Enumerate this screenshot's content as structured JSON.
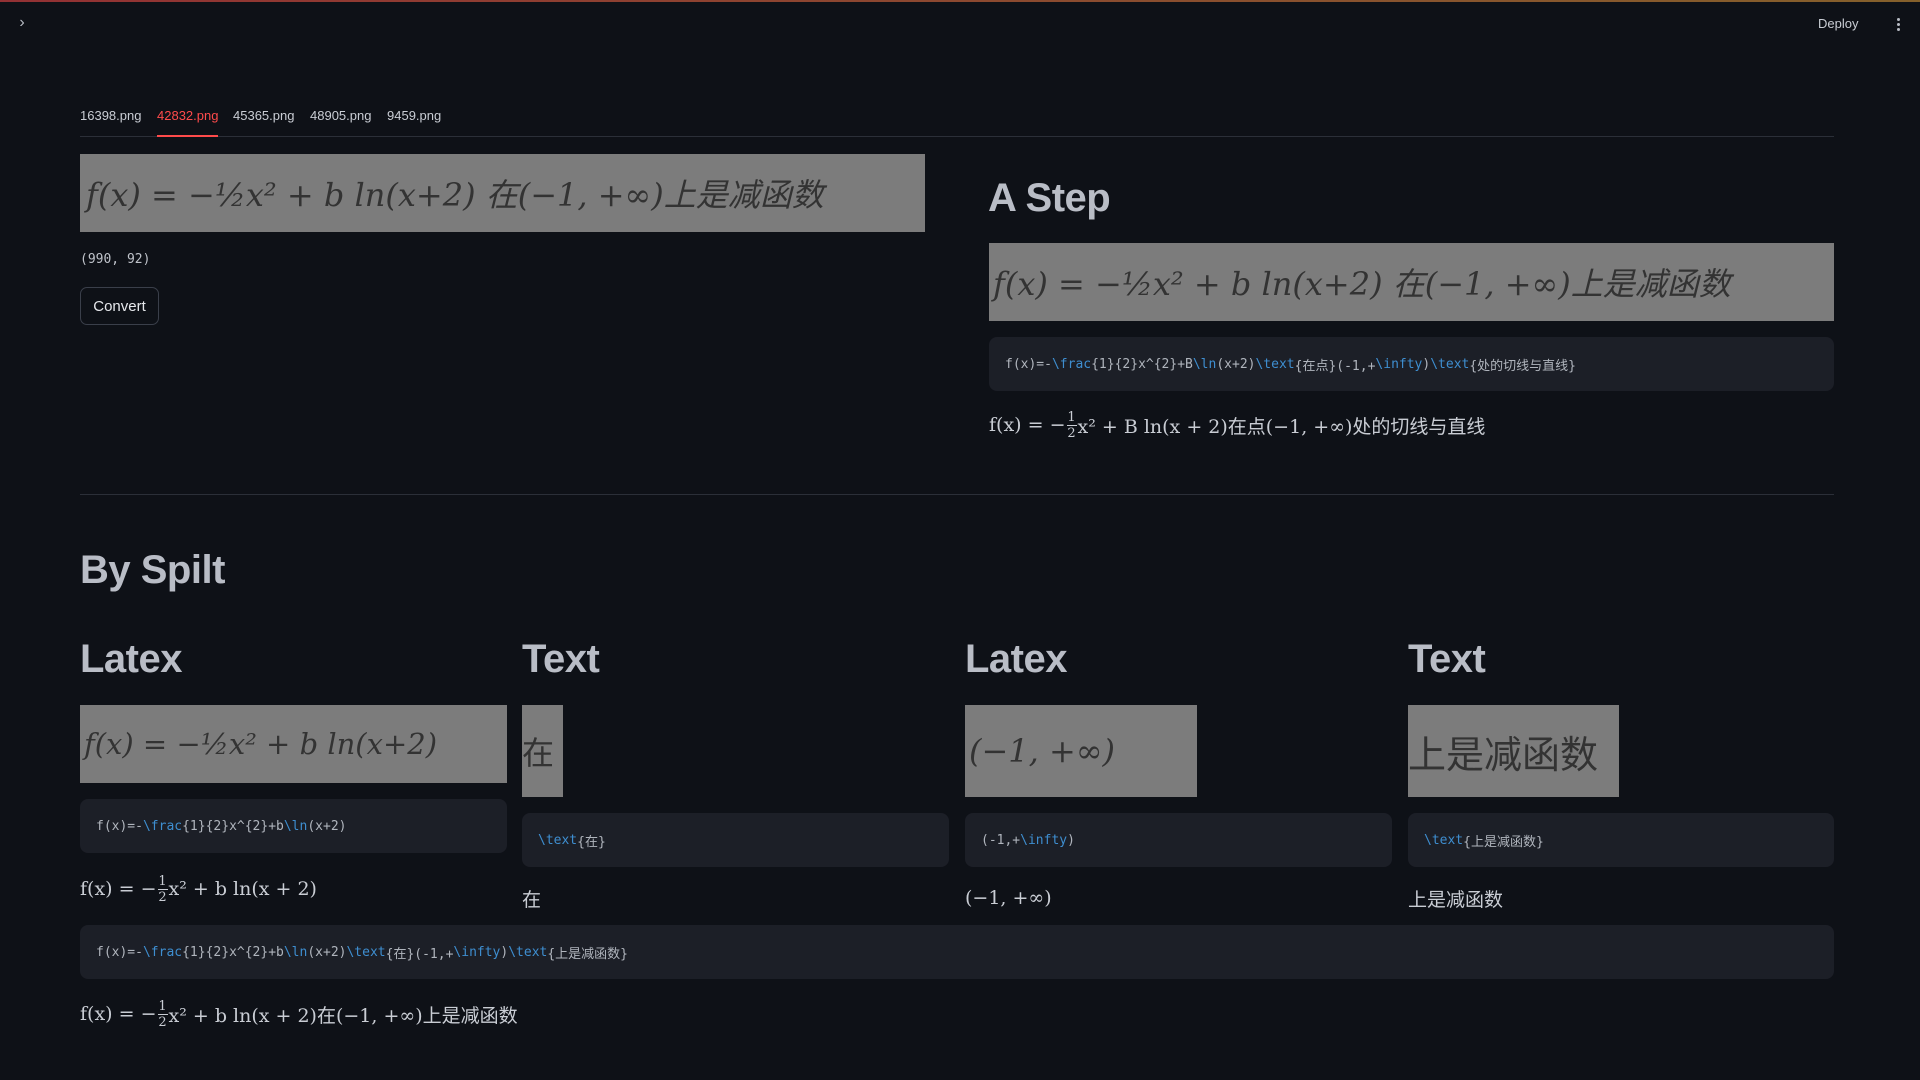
{
  "header": {
    "deploy_label": "Deploy",
    "expand_icon": "chevron-right-icon",
    "menu_icon": "kebab-menu-icon"
  },
  "tabs": [
    "16398.png",
    "42832.png",
    "45365.png",
    "48905.png",
    "9459.png"
  ],
  "active_tab": "42832.png",
  "left": {
    "image_formula": "f(x) = −½x² + b ln(x+2) 在(−1, +∞)上是减函数",
    "image_size": "(990, 92)",
    "convert_label": "Convert"
  },
  "a_step": {
    "heading": "A Step",
    "image_formula": "f(x) = −½x² + b ln(x+2) 在(−1, +∞)上是减函数",
    "code": "f(x)=-\\frac{1}{2}x^{2}+B\\ln(x+2)\\text{在点}(-1,+\\infty)\\text{处的切线与直线}",
    "rendered_before": "f(x) = −",
    "rendered_after": "x² + B ln(x + 2)在点(−1, +∞)处的切线与直线"
  },
  "by_split": {
    "heading": "By Spilt",
    "columns": [
      {
        "kind": "Latex",
        "image_text": "f(x) = −½x² + b ln(x+2)",
        "code": "f(x)=-\\frac{1}{2}x^{2}+b\\ln(x+2)",
        "rendered_before": "f(x) = −",
        "rendered_after": "x² + b ln(x + 2)"
      },
      {
        "kind": "Text",
        "image_text": "在",
        "code": "\\text{在}",
        "rendered": "在"
      },
      {
        "kind": "Latex",
        "image_text": "(−1, +∞)",
        "code": "(-1,+\\infty)",
        "rendered": "(−1, +∞)"
      },
      {
        "kind": "Text",
        "image_text": "上是减函数",
        "code": "\\text{上是减函数}",
        "rendered": "上是减函数"
      }
    ],
    "combined_code": "f(x)=-\\frac{1}{2}x^{2}+b\\ln(x+2)\\text{在}(-1,+\\infty)\\text{上是减函数}",
    "combined_before": "f(x) = −",
    "combined_after": "x² + b ln(x + 2)在(−1, +∞)上是减函数",
    "frac_num": "1",
    "frac_den": "2"
  },
  "colors": {
    "background": "#0e1117",
    "accent": "#ff4b4b",
    "code_keyword": "#3e8ed0",
    "code_bg": "#1c1f27",
    "image_bg": "#7c7c7c"
  }
}
